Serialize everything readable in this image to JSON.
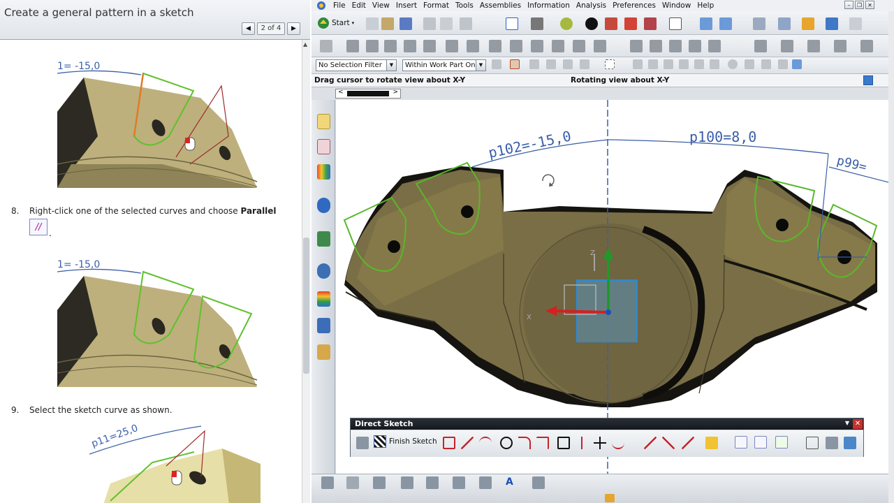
{
  "help": {
    "title": "Create a general pattern in a sketch",
    "pager": {
      "prev_icon": "triangle-left-icon",
      "count": "2 of 4",
      "next_icon": "triangle-right-icon"
    },
    "steps": [
      {
        "number": "8.",
        "text_before": "Right-click one of the selected curves and choose ",
        "bold": "Parallel",
        "text_after": "."
      },
      {
        "number": "9.",
        "text": "Select the sketch curve as shown."
      }
    ],
    "parallel_icon_glyph": "//",
    "figure_labels": {
      "fig1_dim": "1= -15,0",
      "fig2_dim": "1= -15,0",
      "fig3_dim": "p11=25,0"
    }
  },
  "nx": {
    "menus": [
      "File",
      "Edit",
      "View",
      "Insert",
      "Format",
      "Tools",
      "Assemblies",
      "Information",
      "Analysis",
      "Preferences",
      "Window",
      "Help"
    ],
    "start_label": "Start",
    "selection_filter": "No Selection Filter",
    "scope_filter": "Within Work Part Only",
    "cue_left": "Drag cursor to rotate view about X-Y",
    "cue_right": "Rotating view about X-Y",
    "dimensions": {
      "d1": "p102=-15,0",
      "d2": "p100=8,0",
      "d3": "p99="
    },
    "axis_labels": {
      "z": "Z",
      "x": "X"
    },
    "direct_sketch": {
      "title": "Direct Sketch",
      "finish": "Finish Sketch"
    },
    "colors": {
      "part": "#7a6e46",
      "part_shadow": "#151410",
      "curve": "#59b82a",
      "dim": "#3a5ea8",
      "accent": "#3b79c9"
    }
  }
}
